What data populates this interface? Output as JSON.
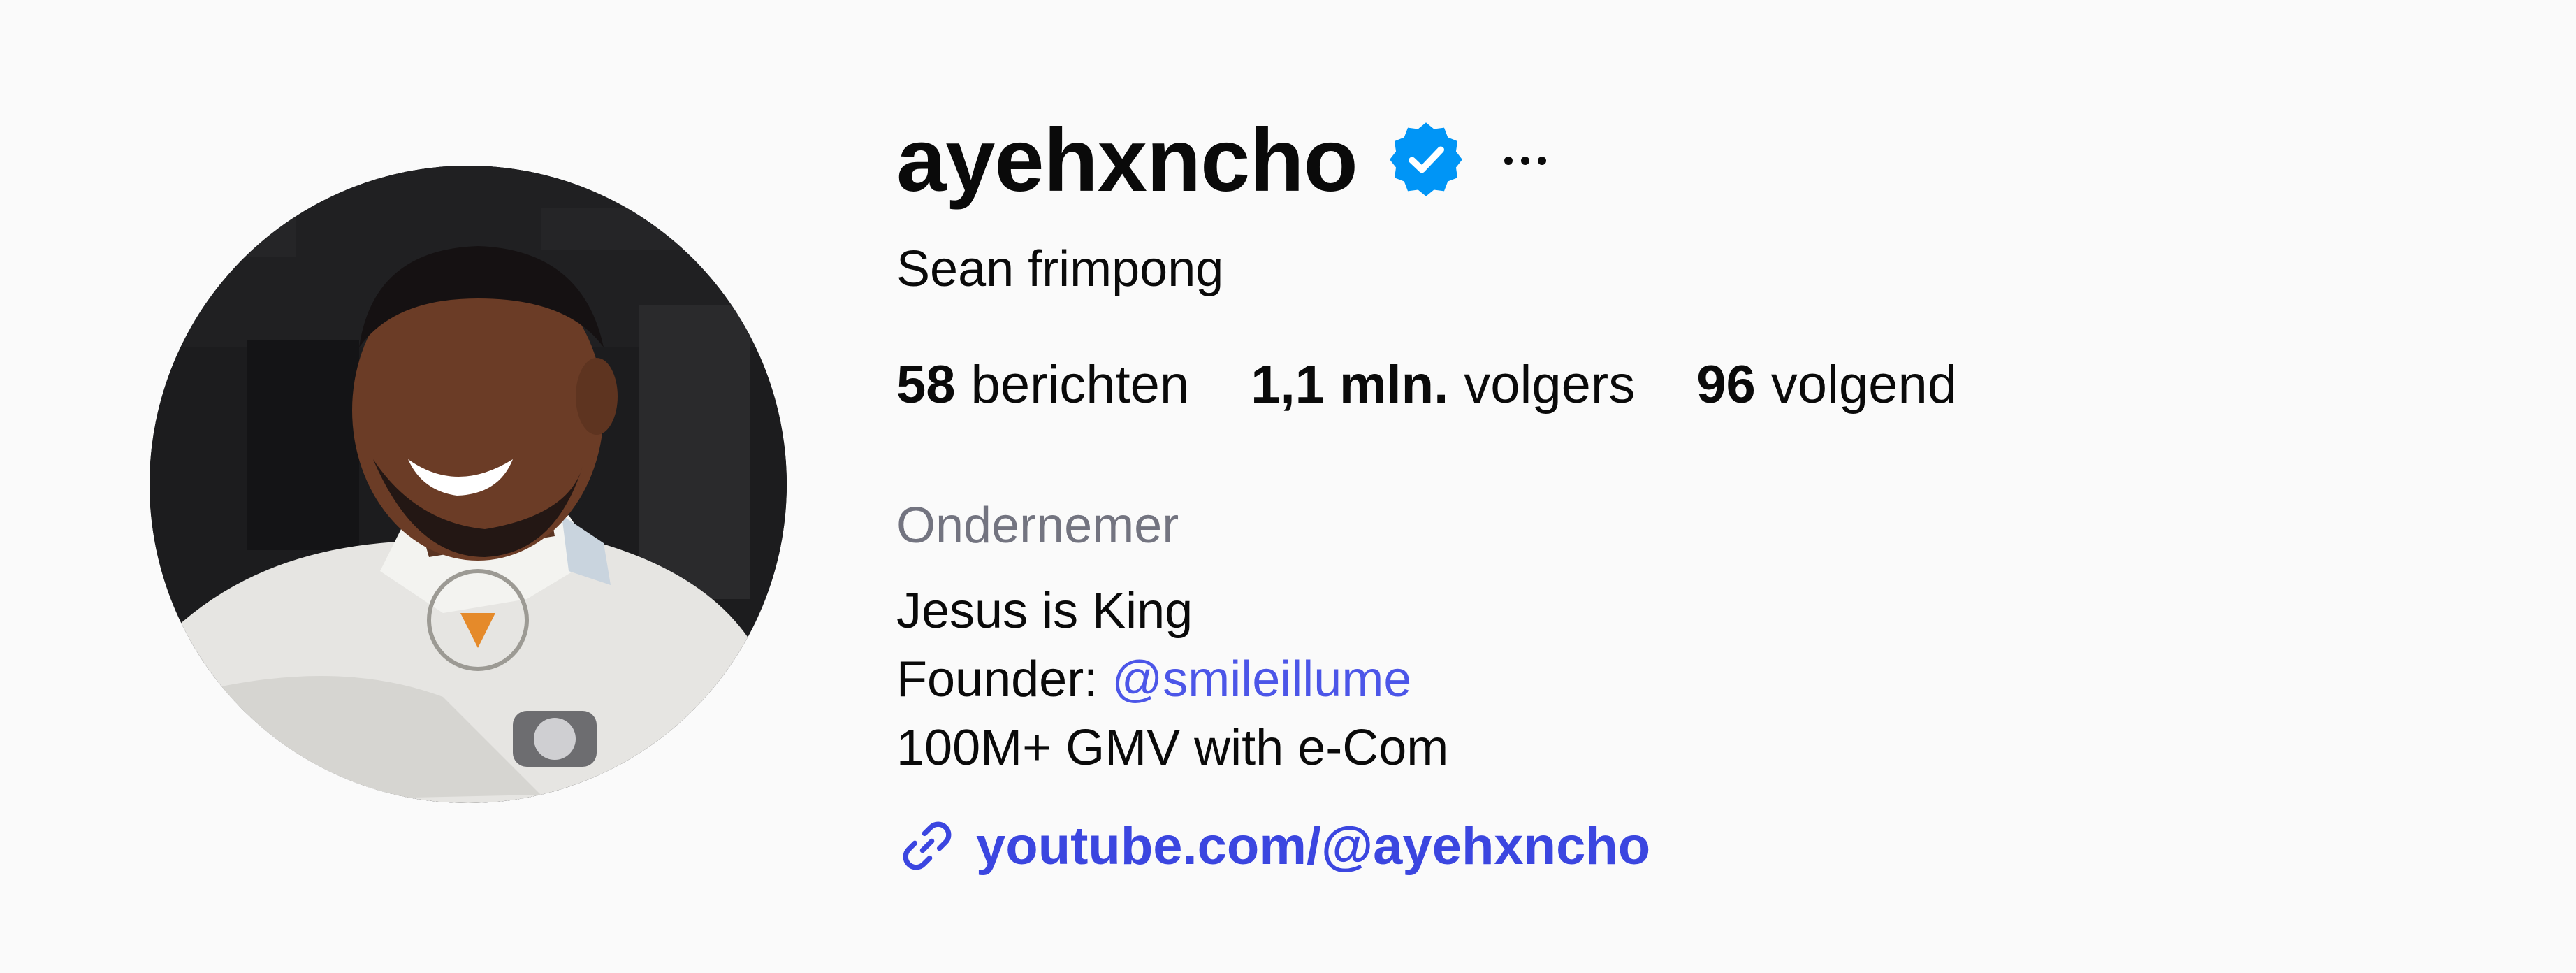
{
  "profile": {
    "username": "ayehxncho",
    "verified_icon": "verified-badge-icon",
    "more_icon": "more-options-icon",
    "full_name": "Sean frimpong",
    "category": "Ondernemer",
    "bio": {
      "line1": "Jesus is King",
      "line2_prefix": "Founder: ",
      "line2_mention": "@smileillume",
      "line3": "100M+ GMV with e-Com"
    },
    "link": {
      "icon": "link-icon",
      "text": "youtube.com/@ayehxncho"
    }
  },
  "stats": {
    "posts": {
      "value": "58",
      "label": "berichten"
    },
    "followers": {
      "value": "1,1 mln.",
      "label": "volgers"
    },
    "following": {
      "value": "96",
      "label": "volgend"
    }
  },
  "colors": {
    "verified": "#0095f6",
    "link": "#3b46e0",
    "mention": "#4c56e8",
    "category": "#737480"
  }
}
